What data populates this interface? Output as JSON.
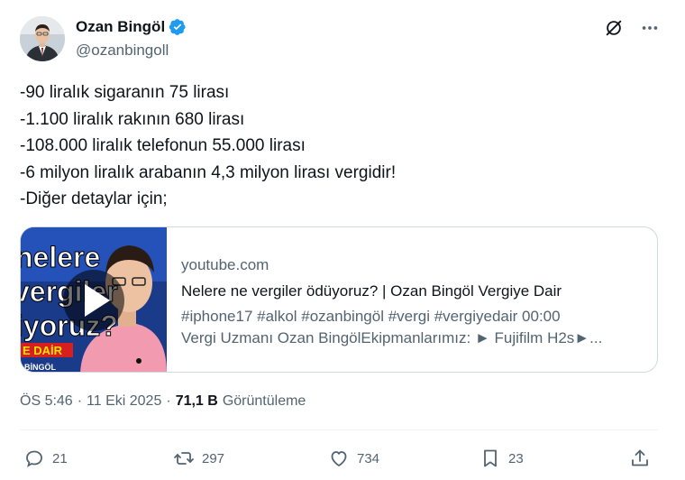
{
  "author": {
    "display_name": "Ozan Bingöl",
    "handle": "@ozanbingoll",
    "avatar_icon": "avatar-photo",
    "verified_icon": "verified-badge-icon",
    "verified_color": "#1d9bf0"
  },
  "top_actions": {
    "grok_icon": "grok-icon",
    "more_icon": "more-icon"
  },
  "tweet": {
    "lines": [
      "-90 liralık sigaranın 75 lirası",
      "-1.100 liralık rakının 680 lirası",
      "-108.000 liralık telefonun 55.000 lirası",
      "-6 milyon liralık arabanın 4,3 milyon lirası vergidir!",
      "-Diğer detaylar için;"
    ]
  },
  "card": {
    "thumb_lines": [
      "nelere",
      "vergiler",
      "iyoruz?"
    ],
    "thumb_banner": "E DAİR",
    "thumb_sub": "BİNGÖL",
    "play_icon": "play-icon",
    "domain": "youtube.com",
    "title": "Nelere ne vergiler ödüyoruz? | Ozan Bingöl Vergiye Dair",
    "desc_line1": "#iphone17 #alkol #ozanbingöl #vergi #vergiyedair 00:00",
    "desc_line2": "Vergi Uzmanı Ozan BingölEkipmanlarımız: ► Fujifilm H2s►..."
  },
  "meta": {
    "time": "ÖS 5:46",
    "sep1": "·",
    "date": "11 Eki 2025",
    "sep2": "·",
    "views_count": "71,1 B",
    "views_label": "Görüntüleme"
  },
  "actions": {
    "replies": "21",
    "reposts": "297",
    "likes": "734",
    "bookmarks": "23"
  },
  "colors": {
    "text": "#0f1419",
    "secondary": "#536471",
    "border": "#cfd9de",
    "verified": "#1d9bf0"
  }
}
